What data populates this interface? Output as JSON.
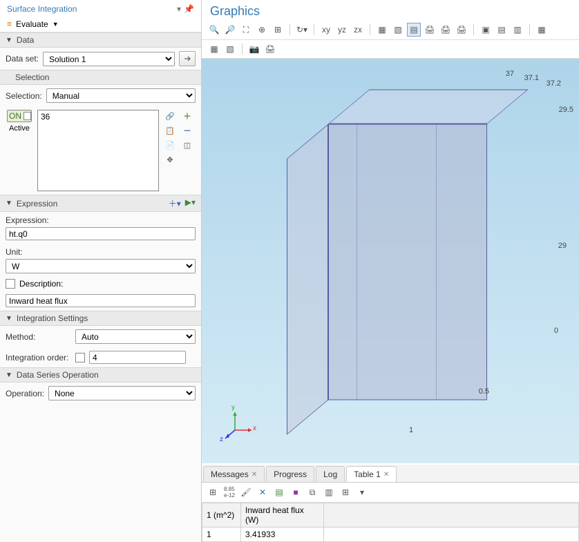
{
  "left": {
    "title": "Surface Integration",
    "evaluate": "Evaluate",
    "sections": {
      "data": {
        "title": "Data",
        "datasetLabel": "Data set:",
        "datasetValue": "Solution 1"
      },
      "selection": {
        "title": "Selection",
        "label": "Selection:",
        "value": "Manual",
        "activeLabel": "Active",
        "onLabel": "ON",
        "listItem": "36"
      },
      "expression": {
        "title": "Expression",
        "exprLabel": "Expression:",
        "exprValue": "ht.q0",
        "unitLabel": "Unit:",
        "unitValue": "W",
        "descLabel": "Description:",
        "descValue": "Inward heat flux"
      },
      "integration": {
        "title": "Integration Settings",
        "methodLabel": "Method:",
        "methodValue": "Auto",
        "orderLabel": "Integration order:",
        "orderValue": "4"
      },
      "dataSeries": {
        "title": "Data Series Operation",
        "opLabel": "Operation:",
        "opValue": "None"
      }
    }
  },
  "right": {
    "title": "Graphics",
    "axisLabels": {
      "t1": "37",
      "t2": "37.1",
      "t3": "37.2",
      "r1": "29.5",
      "r2": "29",
      "r3": "0",
      "b1": "0.5",
      "b2": "1"
    },
    "axes": {
      "x": "x",
      "y": "y",
      "z": "z"
    }
  },
  "tabs": {
    "messages": "Messages",
    "progress": "Progress",
    "log": "Log",
    "table1": "Table 1"
  },
  "table": {
    "col1": "1 (m^2)",
    "col2": "Inward heat flux (W)",
    "r1c1": "1",
    "r1c2": "3.41933"
  }
}
